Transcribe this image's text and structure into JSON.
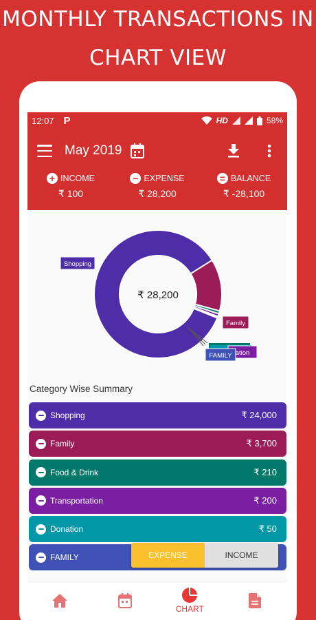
{
  "promo": {
    "line1": "MONTHLY TRANSACTIONS IN",
    "line2": "CHART VIEW"
  },
  "status": {
    "time": "12:07",
    "app_icon": "P",
    "network": "HD",
    "battery": "58%"
  },
  "header": {
    "month": "May 2019"
  },
  "summary": {
    "income_label": "INCOME",
    "income_value": "₹ 100",
    "expense_label": "EXPENSE",
    "expense_value": "₹ 28,200",
    "balance_label": "BALANCE",
    "balance_value": "₹ -28,100"
  },
  "chart_data": {
    "type": "pie",
    "center_label": "₹ 28,200",
    "categories": [
      "Shopping",
      "Family",
      "Food & Drink",
      "Transportation",
      "Donation",
      "FAMILY"
    ],
    "values": [
      24000,
      3700,
      210,
      200,
      50,
      40
    ],
    "colors": [
      "#4e2ea8",
      "#9c1c57",
      "#00796b",
      "#7b1fa2",
      "#0097a7",
      "#3f51b5"
    ],
    "callouts": [
      "Shopping",
      "Family",
      "ation",
      "FAMILY"
    ]
  },
  "category_title": "Category Wise Summary",
  "categories": [
    {
      "name": "Shopping",
      "amount": "₹ 24,000",
      "color": "#4e2ea8"
    },
    {
      "name": "Family",
      "amount": "₹ 3,700",
      "color": "#9c1c57"
    },
    {
      "name": "Food & Drink",
      "amount": "₹ 210",
      "color": "#00796b"
    },
    {
      "name": "Transportation",
      "amount": "₹ 200",
      "color": "#7b1fa2"
    },
    {
      "name": "Donation",
      "amount": "₹ 50",
      "color": "#0097a7"
    },
    {
      "name": "FAMILY",
      "amount": "",
      "color": "#3f51b5"
    }
  ],
  "toggle": {
    "expense": "EXPENSE",
    "income": "INCOME"
  },
  "nav": {
    "chart_label": "CHART"
  }
}
